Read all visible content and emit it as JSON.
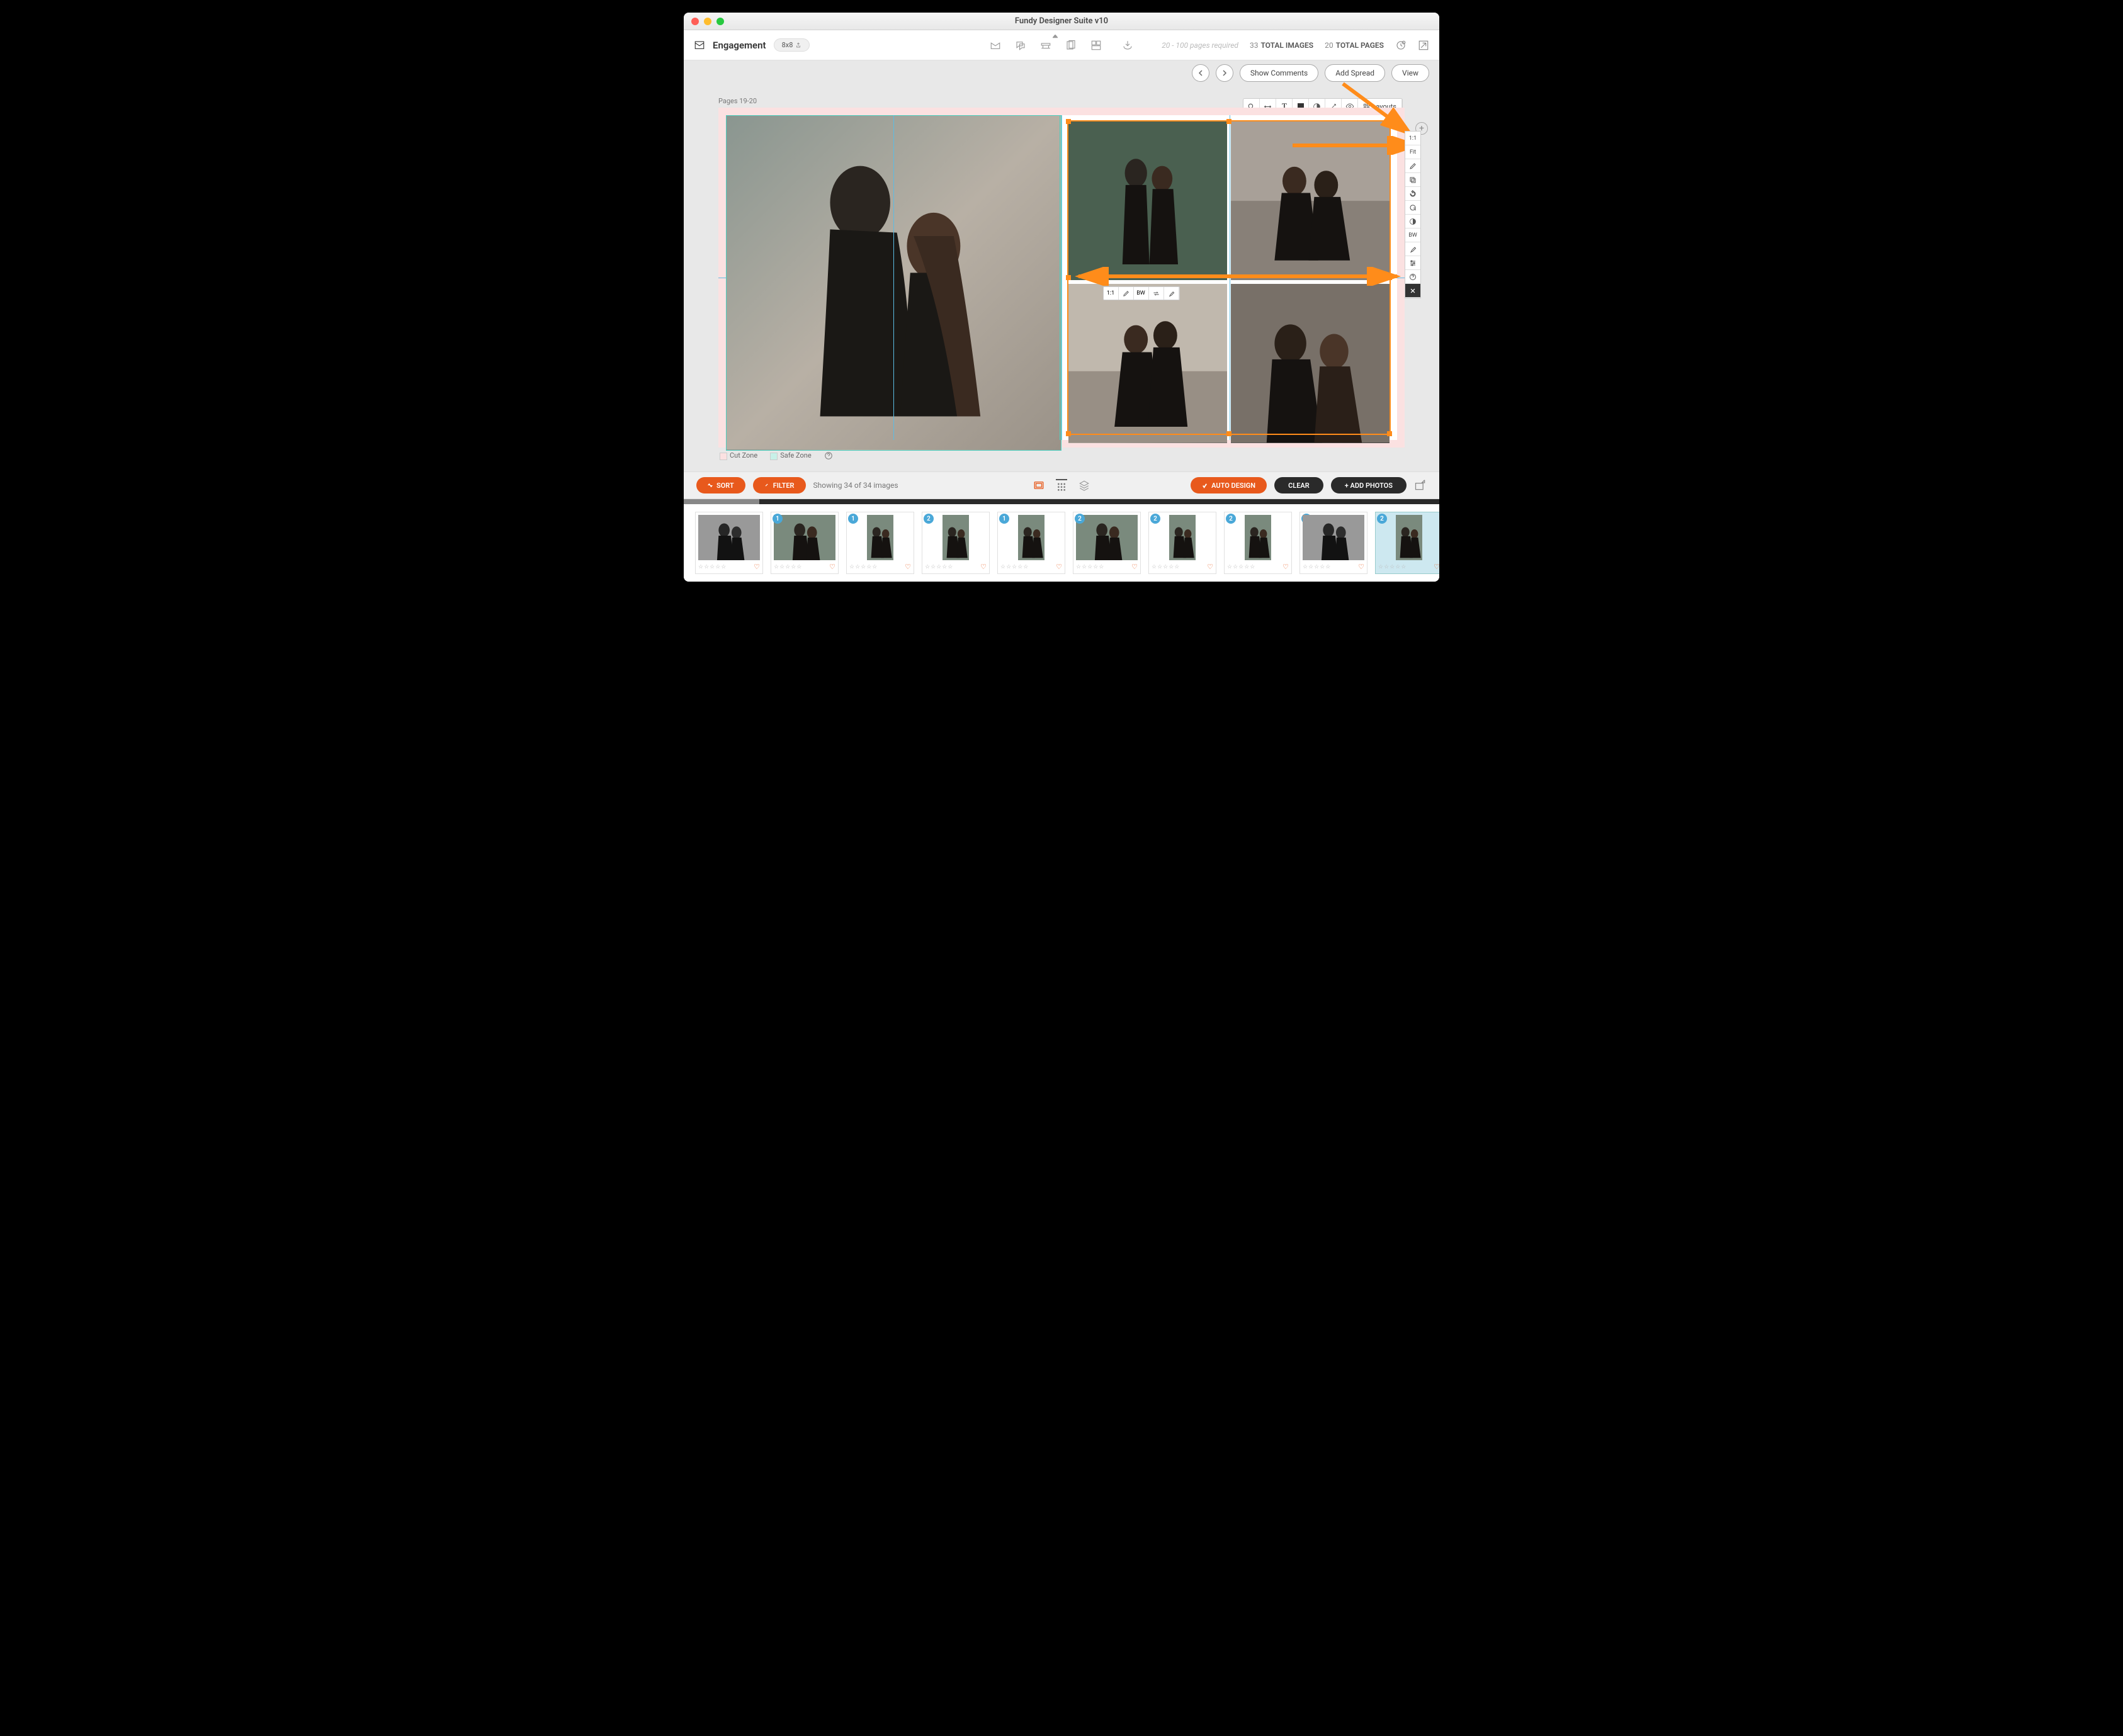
{
  "window": {
    "title": "Fundy Designer Suite v10"
  },
  "toolbar": {
    "project": "Engagement",
    "size": "8x8",
    "pages_required": "20 - 100 pages required",
    "total_images_count": "33",
    "total_images_label": "TOTAL IMAGES",
    "total_pages_count": "20",
    "total_pages_label": "TOTAL PAGES"
  },
  "secondary": {
    "show_comments": "Show Comments",
    "add_spread": "Add Spread",
    "view": "View"
  },
  "canvas": {
    "page_label": "Pages 19-20",
    "layouts_label": "Layouts",
    "cut_zone": "Cut Zone",
    "safe_zone": "Safe Zone"
  },
  "side_panel": {
    "items": [
      "1:1",
      "Fit",
      "pen",
      "copy",
      "rotate",
      "refresh",
      "contrast",
      "BW",
      "dropper",
      "sliders",
      "help",
      "close"
    ]
  },
  "img_tools": {
    "items": [
      "1:1",
      "pen",
      "BW",
      "arrows",
      "dropper"
    ]
  },
  "filter_bar": {
    "sort": "SORT",
    "filter": "FILTER",
    "showing": "Showing 34 of 34 images",
    "auto_design": "AUTO DESIGN",
    "clear": "CLEAR",
    "add_photos": "+ ADD PHOTOS"
  },
  "thumbnails": [
    {
      "badge": "",
      "bw": true,
      "vert": false
    },
    {
      "badge": "1",
      "bw": false,
      "vert": false
    },
    {
      "badge": "1",
      "bw": false,
      "vert": true
    },
    {
      "badge": "2",
      "bw": false,
      "vert": true
    },
    {
      "badge": "1",
      "bw": false,
      "vert": true
    },
    {
      "badge": "2",
      "bw": false,
      "vert": false
    },
    {
      "badge": "2",
      "bw": false,
      "vert": true
    },
    {
      "badge": "2",
      "bw": false,
      "vert": true
    },
    {
      "badge": "2",
      "bw": true,
      "vert": false
    },
    {
      "badge": "2",
      "bw": false,
      "vert": true,
      "selected": true
    }
  ],
  "stars": "☆☆☆☆☆"
}
